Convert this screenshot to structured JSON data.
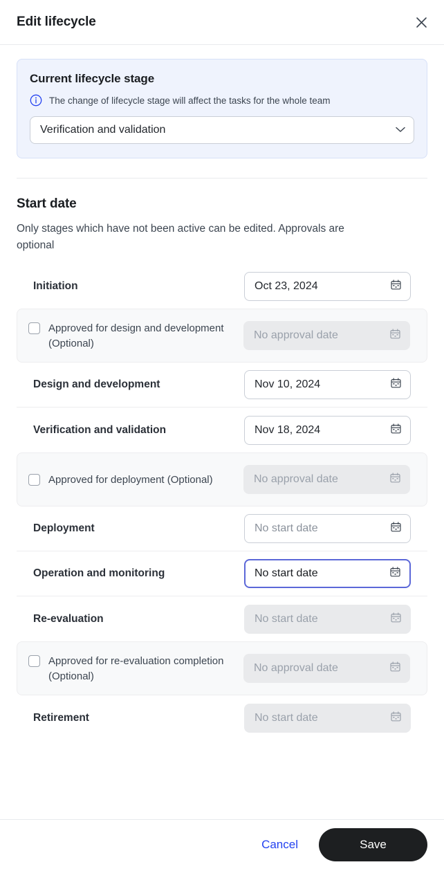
{
  "header": {
    "title": "Edit lifecycle",
    "close_icon": "close-icon"
  },
  "current_stage_panel": {
    "title": "Current lifecycle stage",
    "info_icon": "info-circle-icon",
    "note": "The change of lifecycle stage will affect the tasks for the whole team",
    "select_value": "Verification and validation",
    "chevron_icon": "chevron-down-icon",
    "background_color": "#eff3fd",
    "border_color": "#d6e0f8"
  },
  "start_date_section": {
    "title": "Start date",
    "description": "Only stages which have not been active can be edited. Approvals are optional",
    "rows": [
      {
        "kind": "stage",
        "label": "Initiation",
        "value": "Oct 23, 2024",
        "state": "filled",
        "calendar_icon": "calendar-icon"
      },
      {
        "kind": "approval",
        "label": "Approved for design and development (Optional)",
        "checked": false,
        "value": "No approval date",
        "state": "disabled",
        "calendar_icon": "calendar-icon"
      },
      {
        "kind": "stage",
        "label": "Design and development",
        "value": "Nov 10, 2024",
        "state": "filled",
        "calendar_icon": "calendar-icon"
      },
      {
        "kind": "stage",
        "label": "Verification and validation",
        "value": "Nov 18, 2024",
        "state": "filled",
        "calendar_icon": "calendar-icon"
      },
      {
        "kind": "approval",
        "label": "Approved for deployment (Optional)",
        "checked": false,
        "value": "No approval date",
        "state": "disabled",
        "calendar_icon": "calendar-icon"
      },
      {
        "kind": "stage",
        "label": "Deployment",
        "value": "No start date",
        "state": "placeholder",
        "calendar_icon": "calendar-icon"
      },
      {
        "kind": "stage",
        "label": "Operation and monitoring",
        "value": "No start date",
        "state": "focused",
        "calendar_icon": "calendar-icon"
      },
      {
        "kind": "stage",
        "label": "Re-evaluation",
        "value": "No start date",
        "state": "disabled",
        "calendar_icon": "calendar-icon"
      },
      {
        "kind": "approval",
        "label": "Approved for re-evaluation completion (Optional)",
        "checked": false,
        "value": "No approval date",
        "state": "disabled",
        "calendar_icon": "calendar-icon"
      },
      {
        "kind": "stage",
        "label": "Retirement",
        "value": "No start date",
        "state": "disabled",
        "calendar_icon": "calendar-icon"
      }
    ]
  },
  "footer": {
    "cancel_label": "Cancel",
    "save_label": "Save",
    "cancel_color": "#2442f0",
    "save_background": "#1d1f21"
  }
}
